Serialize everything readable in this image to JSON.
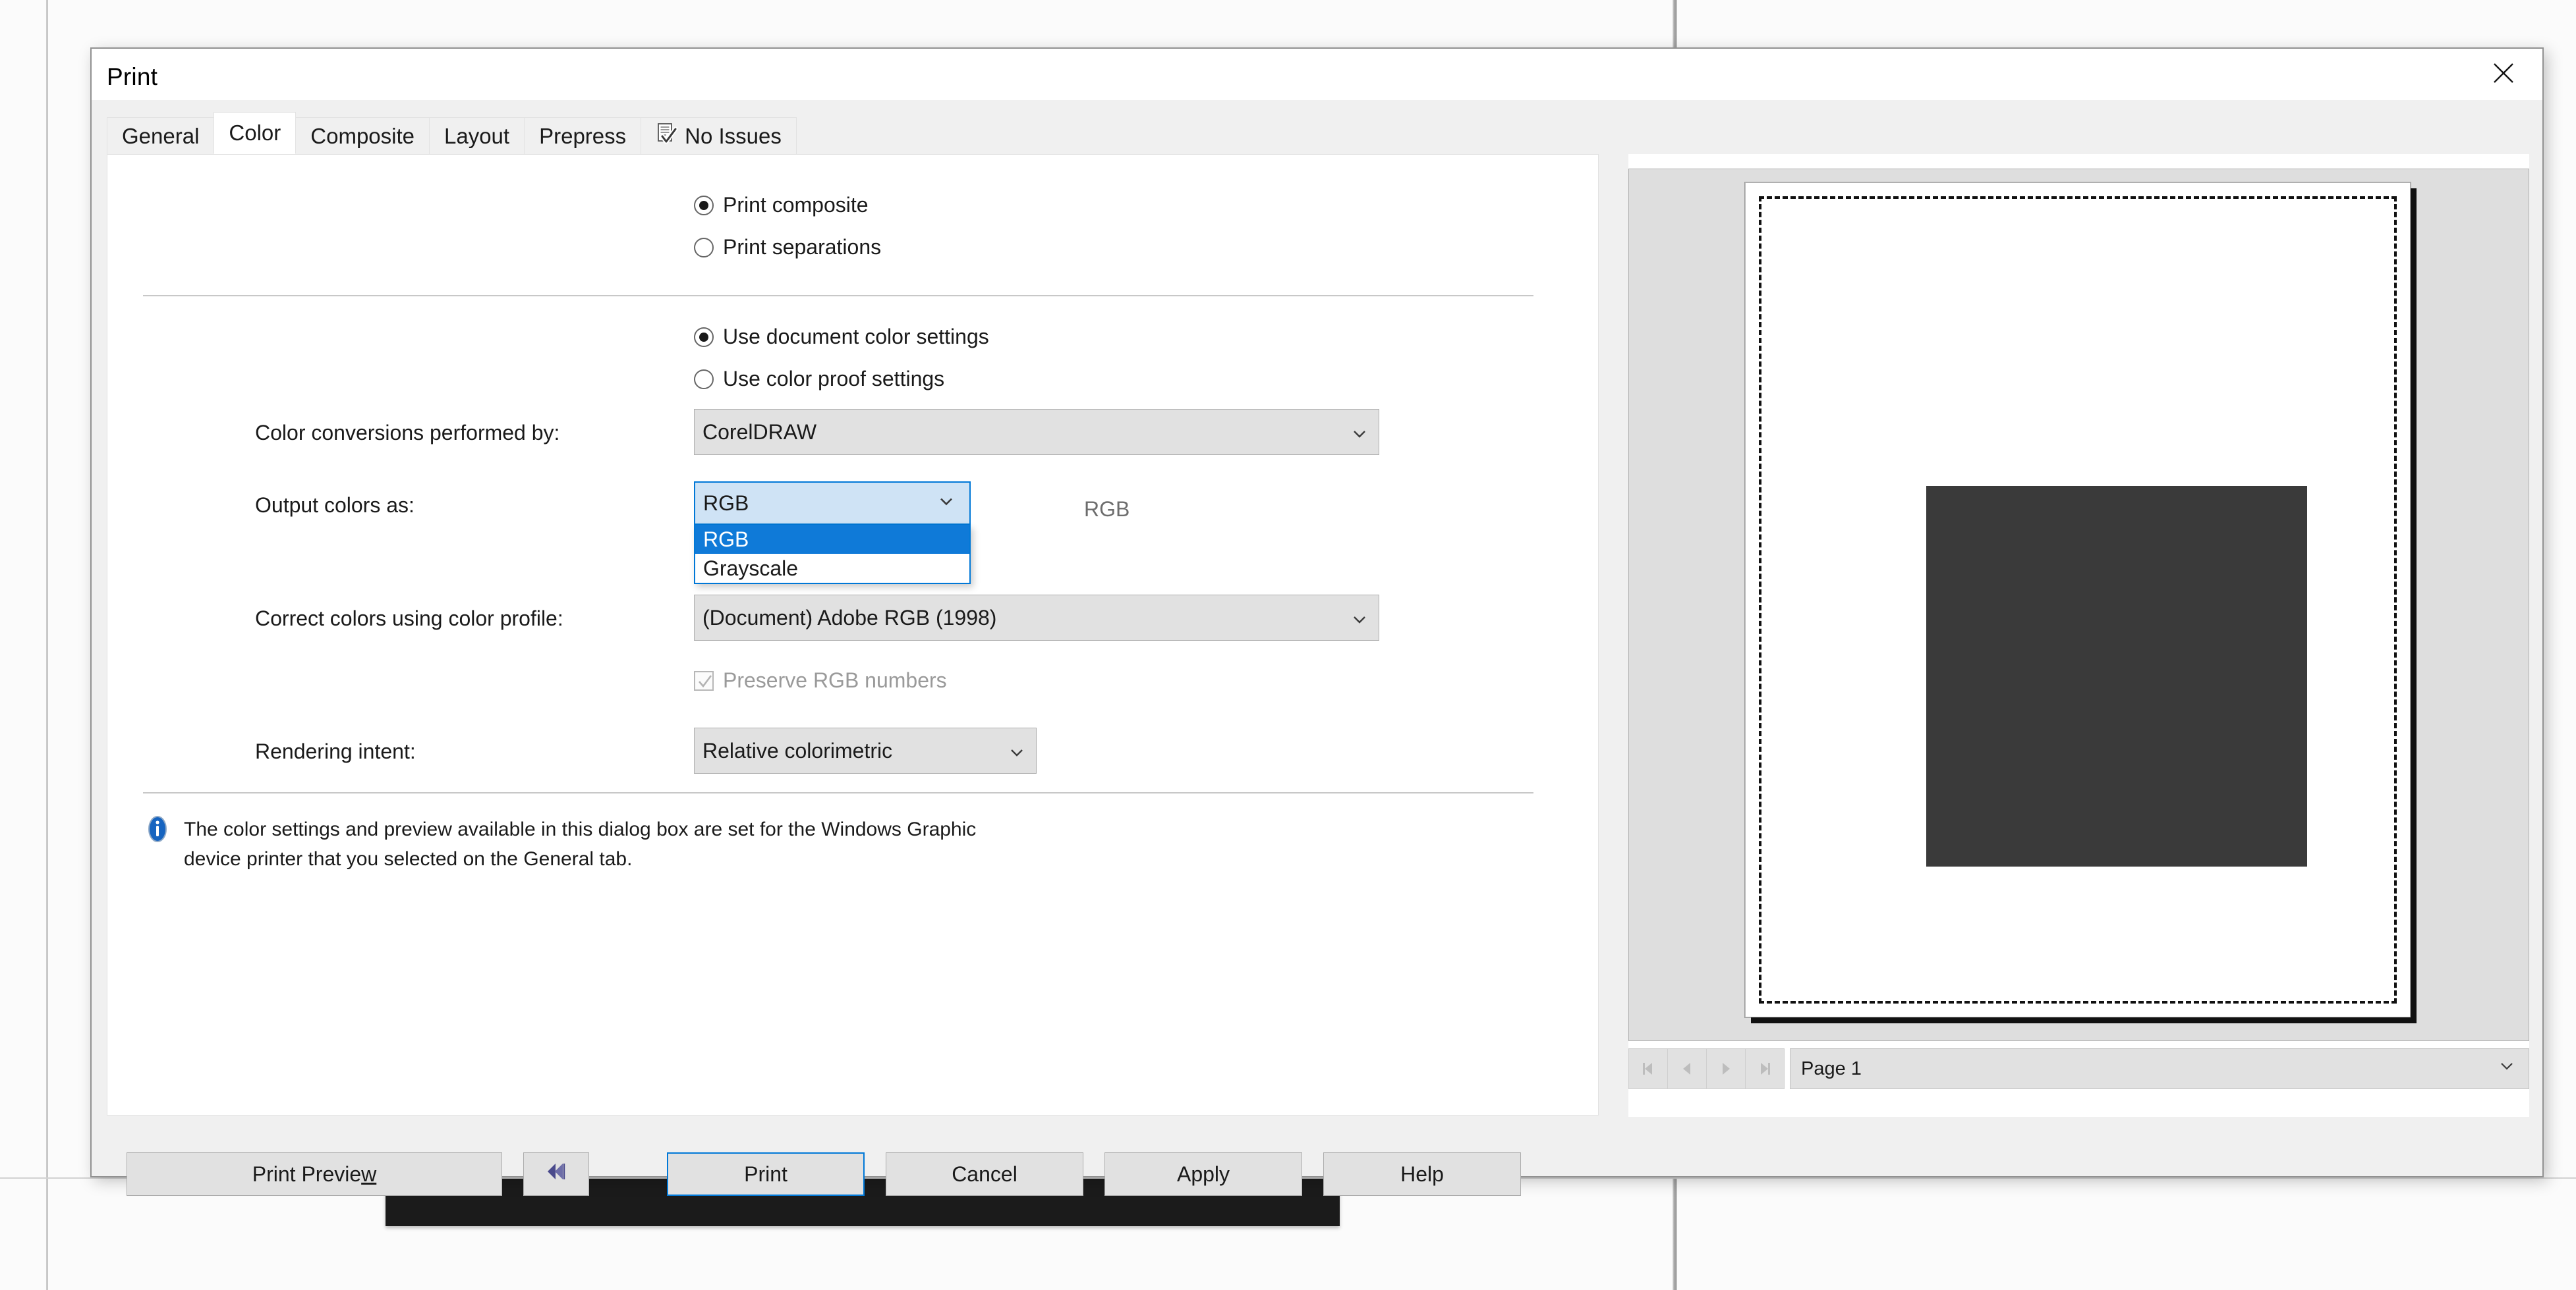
{
  "dialog": {
    "title": "Print",
    "close_icon": "close-icon"
  },
  "tabs": [
    {
      "label": "General",
      "active": false,
      "icon": null
    },
    {
      "label": "Color",
      "active": true,
      "icon": null
    },
    {
      "label": "Composite",
      "active": false,
      "icon": null
    },
    {
      "label": "Layout",
      "active": false,
      "icon": null
    },
    {
      "label": "Prepress",
      "active": false,
      "icon": null
    },
    {
      "label": "No Issues",
      "active": false,
      "icon": "document-check-icon"
    }
  ],
  "color_tab": {
    "composite_group": {
      "options": [
        {
          "label": "Print composite",
          "checked": true
        },
        {
          "label": "Print separations",
          "checked": false
        }
      ]
    },
    "color_settings_group": {
      "options": [
        {
          "label": "Use document color settings",
          "checked": true
        },
        {
          "label": "Use color proof settings",
          "checked": false
        }
      ]
    },
    "conversions": {
      "label": "Color conversions performed by:",
      "value": "CorelDRAW"
    },
    "output_colors": {
      "label": "Output colors as:",
      "value": "RGB",
      "expanded": true,
      "options": [
        {
          "label": "RGB",
          "selected": true
        },
        {
          "label": "Grayscale",
          "selected": false
        }
      ],
      "obscured_text": "RGB"
    },
    "correct_colors": {
      "label": "Correct colors using color profile:",
      "value": "(Document) Adobe RGB (1998)"
    },
    "preserve_rgb": {
      "label": "Preserve RGB numbers",
      "checked": true,
      "disabled": true
    },
    "rendering_intent": {
      "label": "Rendering intent:",
      "value": "Relative colorimetric"
    },
    "info": {
      "icon": "info-icon",
      "line1": "The color settings and preview available in this dialog box are set for the Windows Graphic",
      "line2": "device printer that you selected on the General tab."
    }
  },
  "buttons": {
    "print_preview": {
      "label": "Print Previe",
      "accesskey": "w"
    },
    "collapse": {
      "icon": "rewind-icon"
    },
    "print": "Print",
    "cancel": "Cancel",
    "apply": "Apply",
    "help": "Help"
  },
  "preview": {
    "page_nav": {
      "first_icon": "first-page-icon",
      "prev_icon": "previous-page-icon",
      "next_icon": "next-page-icon",
      "last_icon": "last-page-icon",
      "page_label": "Page 1"
    }
  },
  "colors": {
    "accent": "#0078d7",
    "list_selection": "#0f7ad8",
    "combo_open_bg": "#cfe3f5",
    "control_bg": "#e1e1e1",
    "tabstrip_bg": "#f0f0f0",
    "preview_bg": "#dedede",
    "page_object": "#3a3a3a"
  }
}
